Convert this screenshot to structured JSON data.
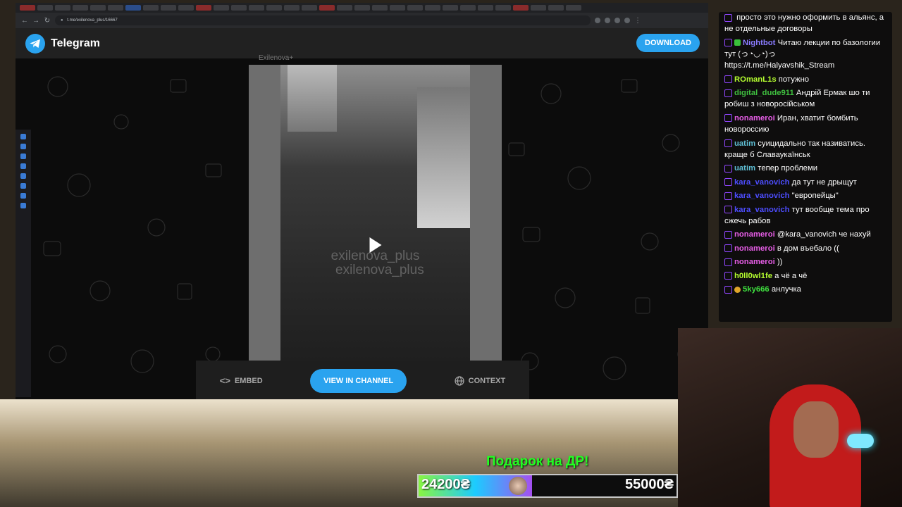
{
  "browser": {
    "url": "t.me/exilenova_plus/16667"
  },
  "header": {
    "app_name": "Telegram",
    "download_label": "DOWNLOAD"
  },
  "post": {
    "channel_name": "Exilenova+",
    "watermark": "exilenova_plus"
  },
  "actions": {
    "embed_label": "EMBED",
    "view_label": "VIEW IN CHANNEL",
    "context_label": "CONTEXT"
  },
  "chat": {
    "messages": [
      {
        "user": "",
        "color": "#ffffff",
        "text": "просто это нужно оформить в альянс, а не отдельные договоры"
      },
      {
        "user": "Nightbot",
        "color": "#8a7bff",
        "text": "Читаю лекции по базологии тут (っ◔◡◔)っ https://t.me/Halyavshik_Stream"
      },
      {
        "user": "ROmanL1s",
        "color": "#b6ff30",
        "text": "потужно"
      },
      {
        "user": "digital_dude911",
        "color": "#3fbf3f",
        "text": "Андрій Ермак шо ти робиш з новоросійськом"
      },
      {
        "user": "nonameroi",
        "color": "#e85ee8",
        "text": "Иран, хватит бомбить новороссию"
      },
      {
        "user": "uatim",
        "color": "#5fbfd5",
        "text": "суицидально так називатись. краще б Славаукаїнськ"
      },
      {
        "user": "uatim",
        "color": "#5fbfd5",
        "text": "тепер проблеми"
      },
      {
        "user": "kara_vanovich",
        "color": "#4d4dff",
        "text": "да тут не дрыщут"
      },
      {
        "user": "kara_vanovich",
        "color": "#4d4dff",
        "text": "\"европейцы\""
      },
      {
        "user": "kara_vanovich",
        "color": "#4d4dff",
        "text": "тут вообще тема про сжечь рабов"
      },
      {
        "user": "nonameroi",
        "color": "#e85ee8",
        "text": "@kara_vanovich че нахуй"
      },
      {
        "user": "nonameroi",
        "color": "#e85ee8",
        "text": "в дом въебало (("
      },
      {
        "user": "nonameroi",
        "color": "#e85ee8",
        "text": "))"
      },
      {
        "user": "h0ll0wl1fe",
        "color": "#b6ff30",
        "text": "а чё а чё"
      },
      {
        "user": "5ky666",
        "color": "#3fe03f",
        "text": "анлучка"
      }
    ]
  },
  "goal": {
    "title": "Подарок на ДР!",
    "current": "24200₴",
    "target": "55000₴",
    "progress": 0.44
  }
}
